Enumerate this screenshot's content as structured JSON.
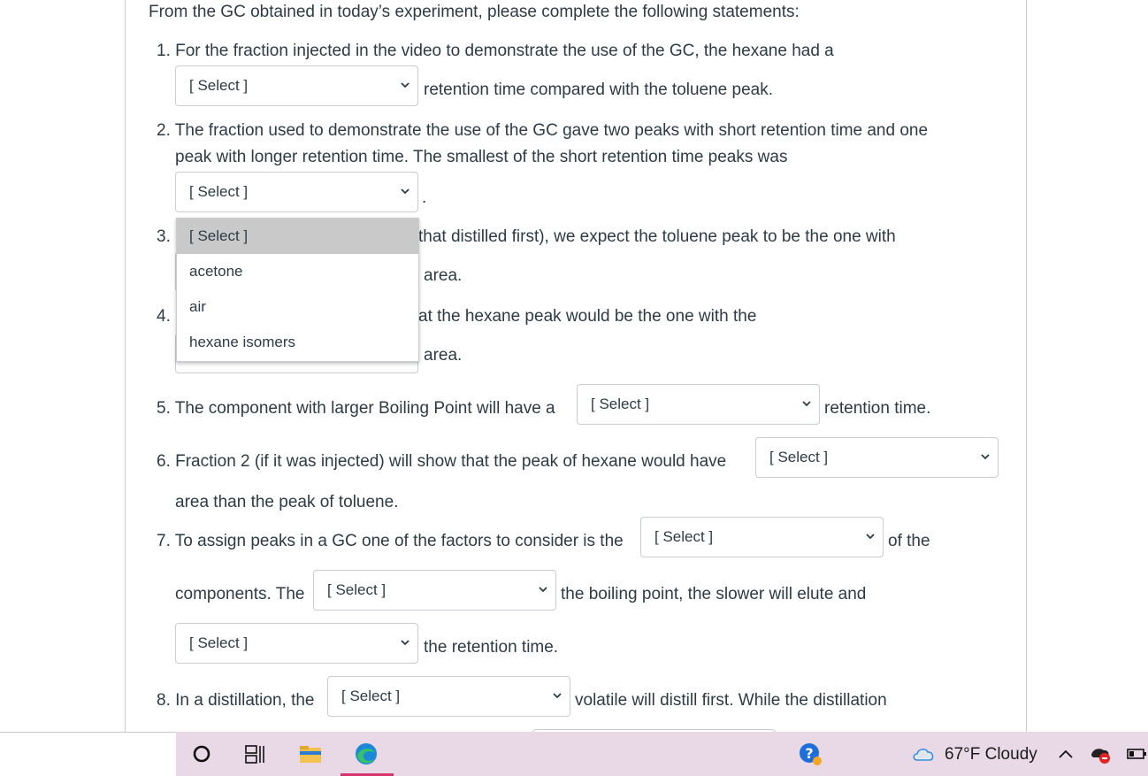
{
  "intro": "From the GC obtained in today’s experiment, please complete the following statements:",
  "q1": {
    "line1": "1. For the fraction injected in the video to demonstrate the use of the GC, the hexane had a",
    "select": "[ Select ]",
    "after": "retention time compared with the toluene peak."
  },
  "q2": {
    "line1": "2. The fraction used to demonstrate the use of the GC gave two peaks with short retention time and one",
    "line2": "peak with longer retention time. The smallest of the short retention time peaks was",
    "select": "[ Select ]",
    "after": "."
  },
  "q3": {
    "num": "3.",
    "line1_tail": "that distilled first), we expect the toluene peak to be the one with",
    "line2_tail": "area."
  },
  "q4": {
    "num": "4.",
    "line1_tail": "at the hexane peak would be the one with the",
    "line2_tail": "area."
  },
  "dropdown": {
    "options": [
      "[ Select ]",
      "acetone",
      "air",
      "hexane isomers"
    ],
    "highlighted_index": 0
  },
  "q5": {
    "before": "5. The component with larger Boiling Point will have a",
    "select": "[ Select ]",
    "after": "retention time."
  },
  "q6": {
    "before": "6. Fraction 2 (if it was injected) will show that the peak of hexane would have",
    "select": "[ Select ]",
    "line2": "area than the peak of toluene."
  },
  "q7": {
    "before": "7. To assign peaks in a GC one of the factors to consider is the",
    "select1": "[ Select ]",
    "after1": "of the",
    "line2_before": "components. The",
    "select2": "[ Select ]",
    "line2_after": "the boiling point, the slower will elute and",
    "select3": "[ Select ]",
    "line3_after": "the retention time."
  },
  "q8": {
    "before": "8. In a distillation, the",
    "select": "[ Select ]",
    "after": "volatile will distill first. While the distillation"
  },
  "taskbar": {
    "weather": "67°F  Cloudy",
    "icons": [
      "search-circle-icon",
      "task-view-icon",
      "file-explorer-icon",
      "edge-browser-icon",
      "help-app-icon",
      "cloud-icon",
      "chevron-up-icon",
      "network-status-icon",
      "battery-icon"
    ]
  }
}
